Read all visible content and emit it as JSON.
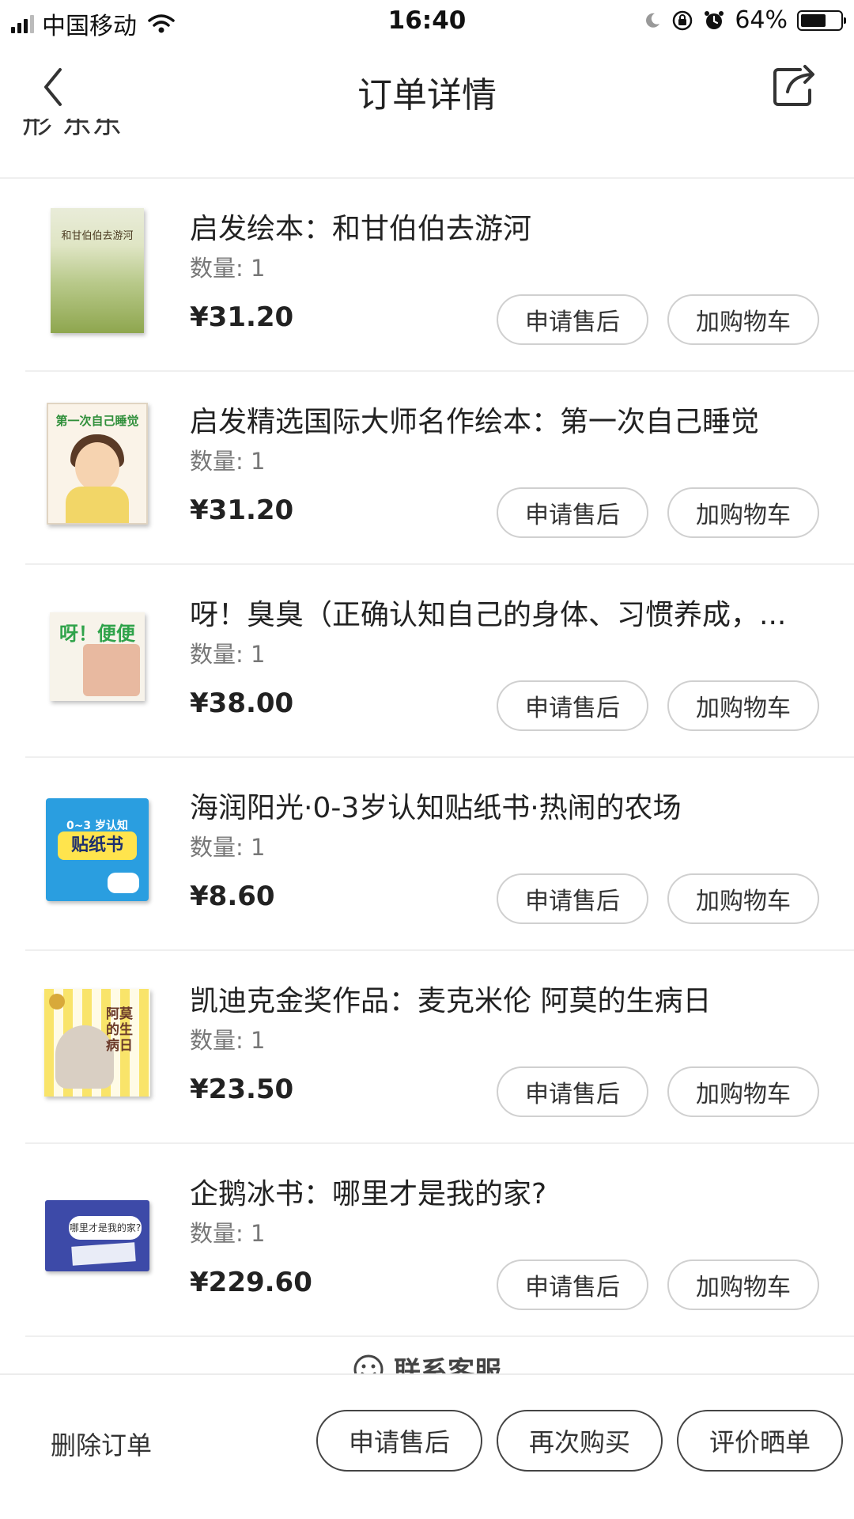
{
  "status_bar": {
    "carrier": "中国移动",
    "time": "16:40",
    "battery_pct": "64%",
    "battery_level": 0.64,
    "icons": [
      "signal-icon",
      "wifi-icon",
      "moon-icon",
      "rotation-lock-icon",
      "alarm-icon",
      "battery-icon"
    ]
  },
  "nav": {
    "title": "订单详情",
    "icons": [
      "back-chevron-icon",
      "share-icon"
    ]
  },
  "shop": {
    "partial_name": "形 东东"
  },
  "items": [
    {
      "title": "启发绘本：和甘伯伯去游河",
      "qty": "数量: 1",
      "price": "¥31.20",
      "cover_text": "和甘伯伯去游河",
      "aftersale_label": "申请售后",
      "addcart_label": "加购物车"
    },
    {
      "title": "启发精选国际大师名作绘本：第一次自己睡觉",
      "qty": "数量: 1",
      "price": "¥31.20",
      "cover_text": "第一次自己睡觉",
      "aftersale_label": "申请售后",
      "addcart_label": "加购物车"
    },
    {
      "title": "呀！臭臭（正确认知自己的身体、习惯养成，...",
      "qty": "数量: 1",
      "price": "¥38.00",
      "cover_text": "呀！便便",
      "aftersale_label": "申请售后",
      "addcart_label": "加购物车"
    },
    {
      "title": "海润阳光·0-3岁认知贴纸书·热闹的农场",
      "qty": "数量: 1",
      "price": "¥8.60",
      "cover_text": "0~3 岁认知",
      "cover_text2": "贴纸书",
      "aftersale_label": "申请售后",
      "addcart_label": "加购物车"
    },
    {
      "title": "凯迪克金奖作品：麦克米伦 阿莫的生病日",
      "qty": "数量: 1",
      "price": "¥23.50",
      "cover_text": "阿莫的生病日",
      "aftersale_label": "申请售后",
      "addcart_label": "加购物车"
    },
    {
      "title": "企鹅冰书：哪里才是我的家?",
      "qty": "数量: 1",
      "price": "¥229.60",
      "cover_text": "哪里才是我的家?",
      "aftersale_label": "申请售后",
      "addcart_label": "加购物车"
    }
  ],
  "contact": {
    "label": "联系客服",
    "icon": "smiley-icon"
  },
  "bottom_bar": {
    "delete_label": "删除订单",
    "aftersale_label": "申请售后",
    "rebuy_label": "再次购买",
    "review_label": "评价晒单"
  }
}
